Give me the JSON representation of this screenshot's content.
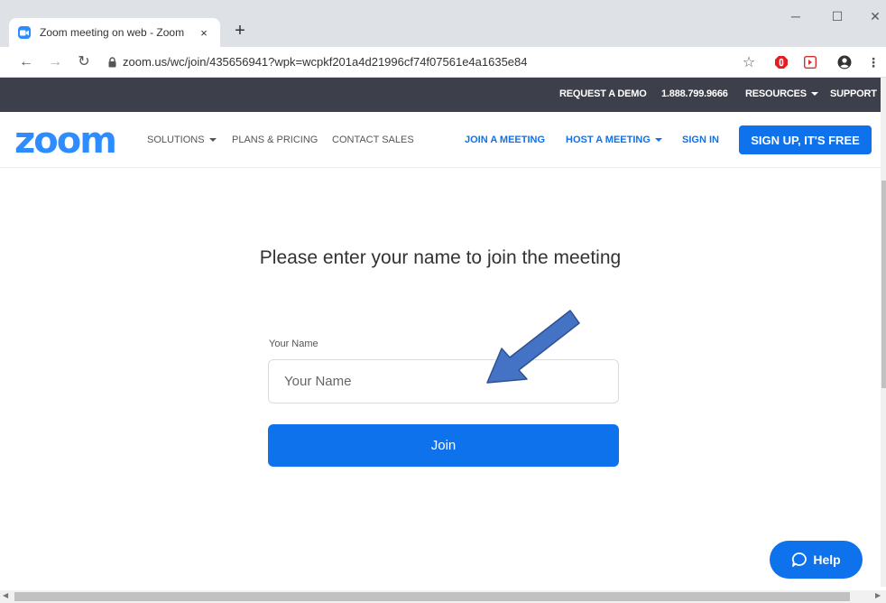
{
  "browser": {
    "tab_title": "Zoom meeting on web - Zoom",
    "tab_close": "×",
    "new_tab": "+",
    "url": "zoom.us/wc/join/435656941?wpk=wcpkf201a4d21996cf74f07561e4a1635e84",
    "icons": [
      "back-arrow-icon",
      "forward-arrow-icon",
      "reload-icon",
      "lock-icon",
      "star-icon",
      "extension-icon",
      "profile-icon",
      "menu-icon"
    ]
  },
  "topbar": {
    "request_demo": "REQUEST A DEMO",
    "phone": "1.888.799.9666",
    "resources": "RESOURCES",
    "support": "SUPPORT"
  },
  "nav": {
    "logo": "zoom",
    "solutions": "SOLUTIONS",
    "plans": "PLANS & PRICING",
    "contact": "CONTACT SALES",
    "join": "JOIN A MEETING",
    "host": "HOST A MEETING",
    "sign_in": "SIGN IN",
    "sign_up": "SIGN UP, IT'S FREE"
  },
  "form": {
    "headline": "Please enter your name to join the meeting",
    "name_label": "Your Name",
    "name_placeholder": "Your Name",
    "join_label": "Join"
  },
  "help": {
    "label": "Help"
  },
  "colors": {
    "brand_blue": "#0e72ed",
    "logo_blue": "#2d8cff",
    "topbar": "#3d3f4b",
    "arrow_annotation": "#4472c4"
  }
}
